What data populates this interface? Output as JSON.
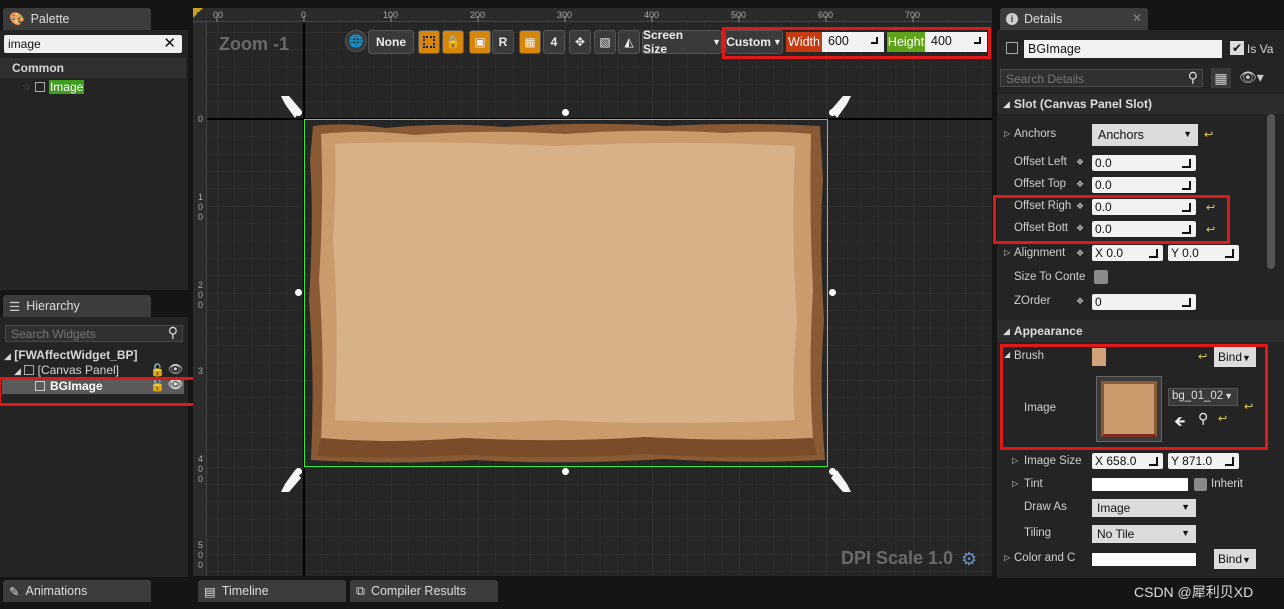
{
  "palette": {
    "tab_label": "Palette",
    "search_value": "image",
    "category": "Common",
    "item_label": "Image"
  },
  "hierarchy": {
    "tab_label": "Hierarchy",
    "search_placeholder": "Search Widgets",
    "root": "[FWAffectWidget_BP]",
    "canvas": "[Canvas Panel]",
    "child": "BGImage"
  },
  "designer": {
    "zoom_label": "Zoom -1",
    "dpi_label": "DPI Scale 1.0",
    "ruler_top": [
      "00",
      "0",
      "100",
      "200",
      "300",
      "400",
      "500",
      "600",
      "700"
    ],
    "ruler_left": [
      "0",
      "1\n0\n0",
      "2\n0\n0",
      "3",
      "4\n0\n0",
      "5\n0\n0"
    ],
    "toolbar": {
      "none_label": "None",
      "r_label": "R",
      "grid_num": "4",
      "screen_size_label": "Screen Size",
      "custom_label": "Custom",
      "width_label": "Width",
      "width_value": "600",
      "height_label": "Height",
      "height_value": "400"
    }
  },
  "details": {
    "tab_label": "Details",
    "name_value": "BGImage",
    "is_variable_label": "Is Va",
    "search_placeholder": "Search Details",
    "slot_section": "Slot (Canvas Panel Slot)",
    "anchors_label": "Anchors",
    "anchors_value": "Anchors",
    "offset_left_label": "Offset Left",
    "offset_left_value": "0.0",
    "offset_top_label": "Offset Top",
    "offset_top_value": "0.0",
    "offset_right_label": "Offset Righ",
    "offset_right_value": "0.0",
    "offset_bottom_label": "Offset Bott",
    "offset_bottom_value": "0.0",
    "alignment_label": "Alignment",
    "alignment_x_label": "X",
    "alignment_x": "0.0",
    "alignment_y_label": "Y",
    "alignment_y": "0.0",
    "size_to_content_label": "Size To Conte",
    "zorder_label": "ZOrder",
    "zorder_value": "0",
    "appearance_section": "Appearance",
    "brush_label": "Brush",
    "bind_label": "Bind",
    "image_label": "Image",
    "image_asset": "bg_01_02",
    "image_size_label": "Image Size",
    "image_size_x_label": "X",
    "image_size_x": "658.0",
    "image_size_y_label": "Y",
    "image_size_y": "871.0",
    "tint_label": "Tint",
    "inherit_label": "Inherit",
    "draw_as_label": "Draw As",
    "draw_as_value": "Image",
    "tiling_label": "Tiling",
    "tiling_value": "No Tile",
    "color_label": "Color and C",
    "bind2_label": "Bind"
  },
  "bottom_tabs": {
    "animations": "Animations",
    "timeline": "Timeline",
    "compiler": "Compiler Results"
  },
  "watermark": "CSDN @犀利贝XD",
  "colors": {
    "width_label_bg": "#c43b12",
    "height_label_bg": "#5fa31b",
    "accent_orange": "#d7860c",
    "parchment": "#d6a97b",
    "selection_green": "#35e83a",
    "highlight_red": "#e01818"
  }
}
